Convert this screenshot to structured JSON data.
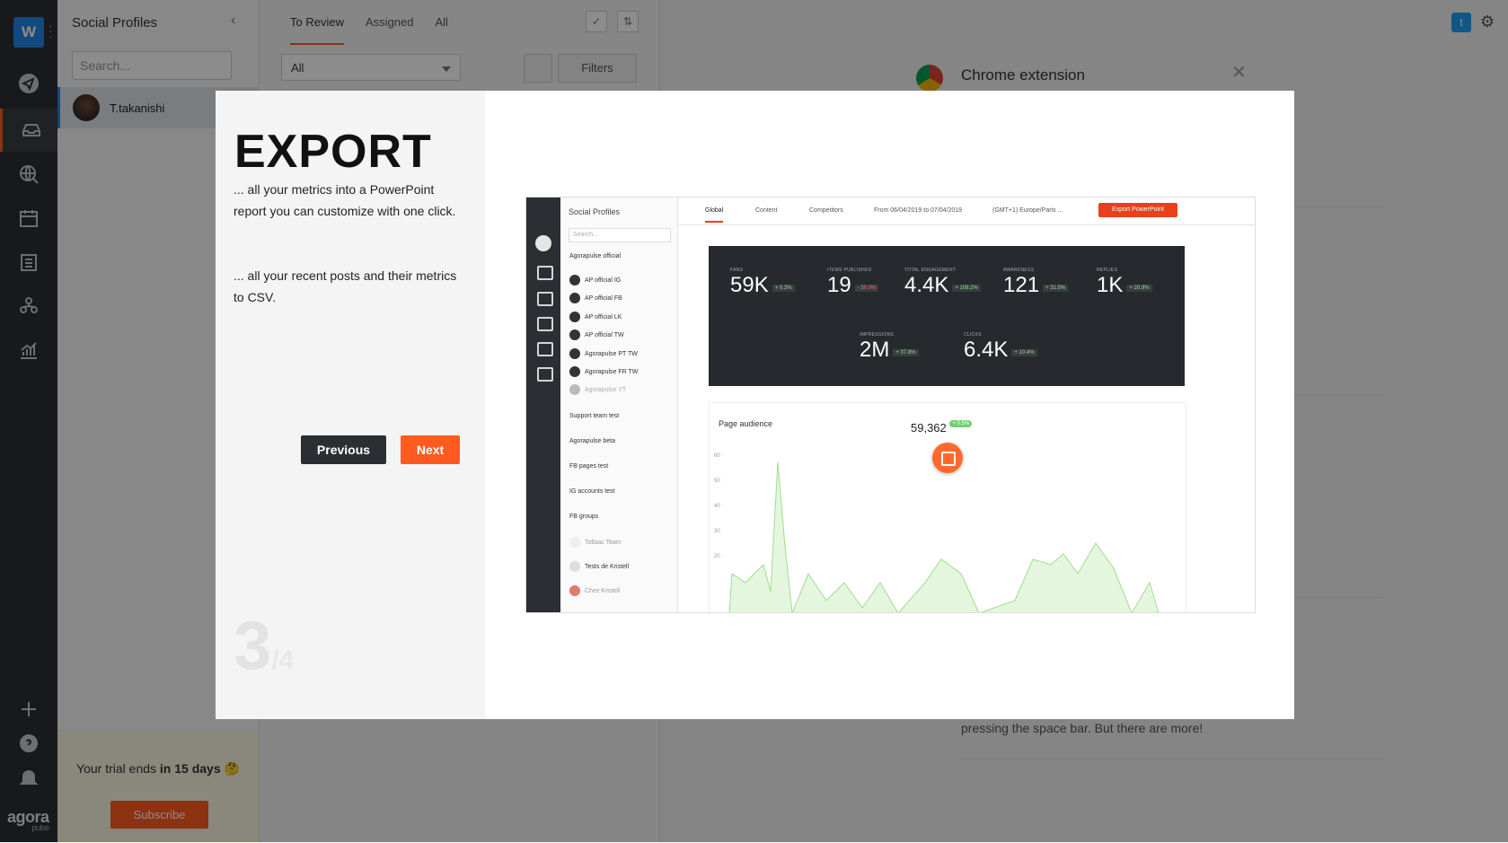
{
  "app": {
    "workspace_initial": "W",
    "logo": "agora",
    "logo_sub": "pulse"
  },
  "profiles": {
    "title": "Social Profiles",
    "search_placeholder": "Search...",
    "items": [
      {
        "name": "T.takanishi"
      }
    ],
    "trial_prefix": "Your trial ends ",
    "trial_bold": "in 15 days",
    "trial_emoji": "🤔",
    "subscribe_label": "Subscribe"
  },
  "inbox": {
    "tabs": [
      {
        "label": "To Review",
        "active": true
      },
      {
        "label": "Assigned",
        "active": false
      },
      {
        "label": "All",
        "active": false
      }
    ],
    "filter_select": "All",
    "filters_label": "Filters"
  },
  "right": {
    "extension_title": "Chrome extension",
    "space_text": "pressing the space bar. But there are more!"
  },
  "modal": {
    "title": "EXPORT",
    "text1": "... all your metrics into a PowerPoint report you can customize with one click.",
    "text2": "... all your recent posts and their metrics to CSV.",
    "prev_label": "Previous",
    "next_label": "Next",
    "step_current": "3",
    "step_total": "/4",
    "preview": {
      "col_title": "Social Profiles",
      "search": "Search...",
      "group": "Agorapulse official",
      "profiles": [
        "AP official IG",
        "AP official FB",
        "AP official LK",
        "AP official TW",
        "Agorapulse PT TW",
        "Agorapulse FR TW",
        "Agorapulse YT"
      ],
      "groups": [
        "Support team test",
        "Agorapulse beta",
        "FB pages test",
        "IG accounts test",
        "FB groups"
      ],
      "extra": [
        "Tolbiac Team",
        "Tests de Kristell",
        "Chez Kristell"
      ],
      "tabs": [
        "Global",
        "Content",
        "Competitors"
      ],
      "date_range": "From 06/04/2019 to 07/04/2019",
      "timezone": "(GMT+1) Europe/Paris ...",
      "export_label": "Export PowerPoint",
      "metrics": [
        {
          "label": "FANS",
          "value": "59K",
          "delta": "+ 0.3%"
        },
        {
          "label": "ITEMS PUBLISHED",
          "value": "19",
          "delta": "- 30.0%"
        },
        {
          "label": "TOTAL ENGAGEMENT",
          "value": "4.4K",
          "delta": "+ 108.2%"
        },
        {
          "label": "AWARENESS",
          "value": "121",
          "delta": "+ 31.5%"
        },
        {
          "label": "REPLIES",
          "value": "1K",
          "delta": "+ 20.9%"
        },
        {
          "label": "IMPRESSIONS",
          "value": "2M",
          "delta": "+ 37.8%"
        },
        {
          "label": "CLICKS",
          "value": "6.4K",
          "delta": "+ 10.4%"
        }
      ],
      "card_title": "Page audience",
      "fans_label": "FANS",
      "fans_value": "59,362",
      "fans_delta": "+ 0.5%",
      "y_ticks": [
        "60",
        "50",
        "40",
        "30",
        "20"
      ]
    }
  },
  "colors": {
    "accent": "#ff5a1f",
    "rail": "#2b2e33",
    "twitter": "#1da1f2"
  }
}
